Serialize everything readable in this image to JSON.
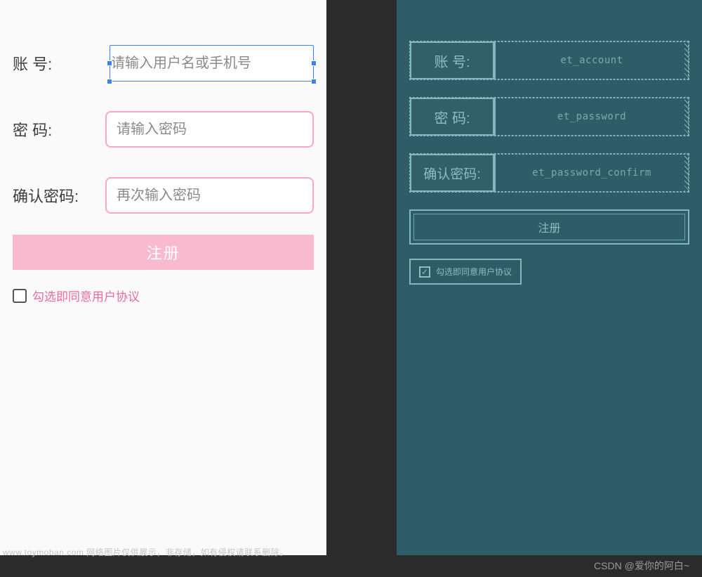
{
  "preview": {
    "fields": {
      "account_label": "账        号:",
      "account_placeholder": "请输入用户名或手机号",
      "password_label": "密        码:",
      "password_placeholder": "请输入密码",
      "confirm_label": "确认密码:",
      "confirm_placeholder": "再次输入密码"
    },
    "register_button": "注册",
    "agree_text": "勾选即同意用户协议"
  },
  "blueprint": {
    "fields": {
      "account_label": "账      号:",
      "account_id": "et_account",
      "password_label": "密      码:",
      "password_id": "et_password",
      "confirm_label": "确认密码:",
      "confirm_id": "et_password_confirm"
    },
    "register_button": "注册",
    "agree_text": "勾选即同意用户协议"
  },
  "footer_note": "www.toymoban.com 网络图片仅供展示，非存储，如有侵权请联系删除。",
  "watermark": "CSDN @爱你的阿白~",
  "colors": {
    "pink_border": "#fca5c6",
    "pink_button": "#f9b9cf",
    "pink_text": "#ec6a9f",
    "blueprint_bg": "#2e5d67",
    "blueprint_line": "#7fb9bd"
  }
}
